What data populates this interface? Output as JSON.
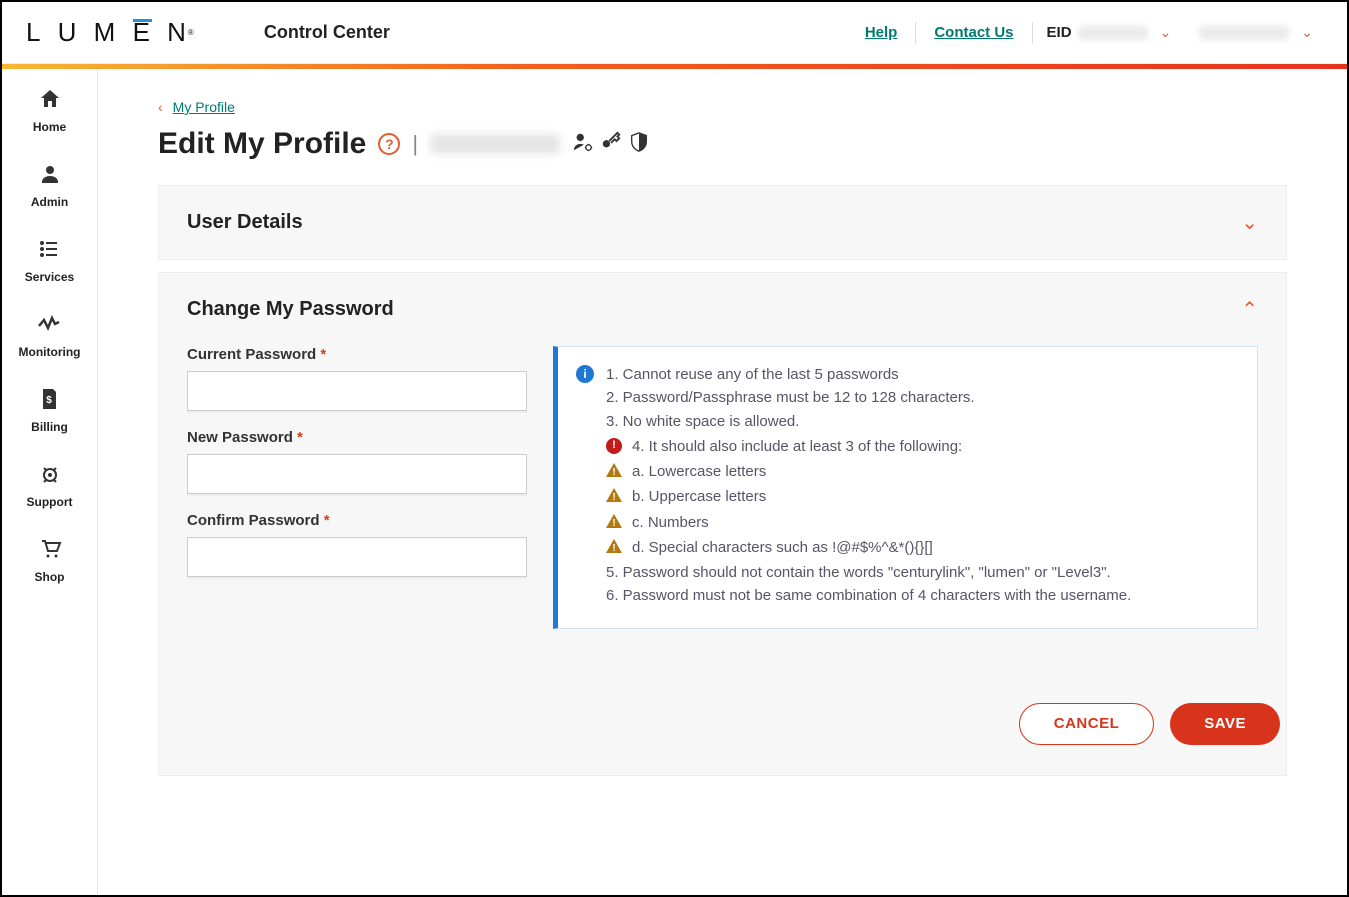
{
  "header": {
    "brand": "LUMEN",
    "app_title": "Control Center",
    "help_label": "Help",
    "contact_label": "Contact Us",
    "eid_label": "EID"
  },
  "sidebar": {
    "items": [
      {
        "label": "Home"
      },
      {
        "label": "Admin"
      },
      {
        "label": "Services"
      },
      {
        "label": "Monitoring"
      },
      {
        "label": "Billing"
      },
      {
        "label": "Support"
      },
      {
        "label": "Shop"
      }
    ]
  },
  "breadcrumb": {
    "back_label": "My Profile"
  },
  "page": {
    "title": "Edit My Profile"
  },
  "panels": {
    "user_details": {
      "title": "User Details"
    },
    "change_password": {
      "title": "Change My Password",
      "fields": {
        "current": "Current Password",
        "new": "New Password",
        "confirm": "Confirm Password",
        "asterisk": "*"
      },
      "rules": {
        "r1": "1. Cannot reuse any of the last 5 passwords",
        "r2": "2. Password/Passphrase must be 12 to 128 characters.",
        "r3": "3. No white space is allowed.",
        "r4": "4. It should also include at least 3 of the following:",
        "r4a": "a. Lowercase letters",
        "r4b": "b. Uppercase letters",
        "r4c": "c. Numbers",
        "r4d": "d. Special characters such as !@#$%^&*(){}[]",
        "r5": "5. Password should not contain the words \"centurylink\", \"lumen\" or \"Level3\".",
        "r6": "6. Password must not be same combination of 4 characters with the username."
      }
    }
  },
  "actions": {
    "cancel": "CANCEL",
    "save": "SAVE"
  }
}
